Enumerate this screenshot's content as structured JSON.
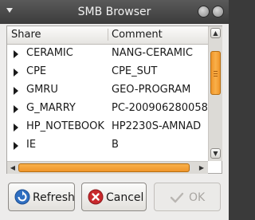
{
  "window": {
    "title": "SMB Browser"
  },
  "columns": {
    "share": "Share",
    "comment": "Comment"
  },
  "rows": [
    {
      "share": "CERAMIC",
      "comment": "NANG-CERAMIC"
    },
    {
      "share": "CPE",
      "comment": "CPE_SUT"
    },
    {
      "share": "GMRU",
      "comment": "GEO-PROGRAM"
    },
    {
      "share": "G_MARRY",
      "comment": "PC-200906280058"
    },
    {
      "share": "HP_NOTEBOOK",
      "comment": "HP2230S-AMNAD"
    },
    {
      "share": "IE",
      "comment": "B"
    }
  ],
  "buttons": {
    "refresh": "Refresh",
    "cancel": "Cancel",
    "ok": "OK"
  },
  "colors": {
    "accent": "#f0952a",
    "titlebar": "#4a4a4a",
    "cancel_icon": "#c8282c",
    "refresh_icon": "#2f6fc1"
  }
}
